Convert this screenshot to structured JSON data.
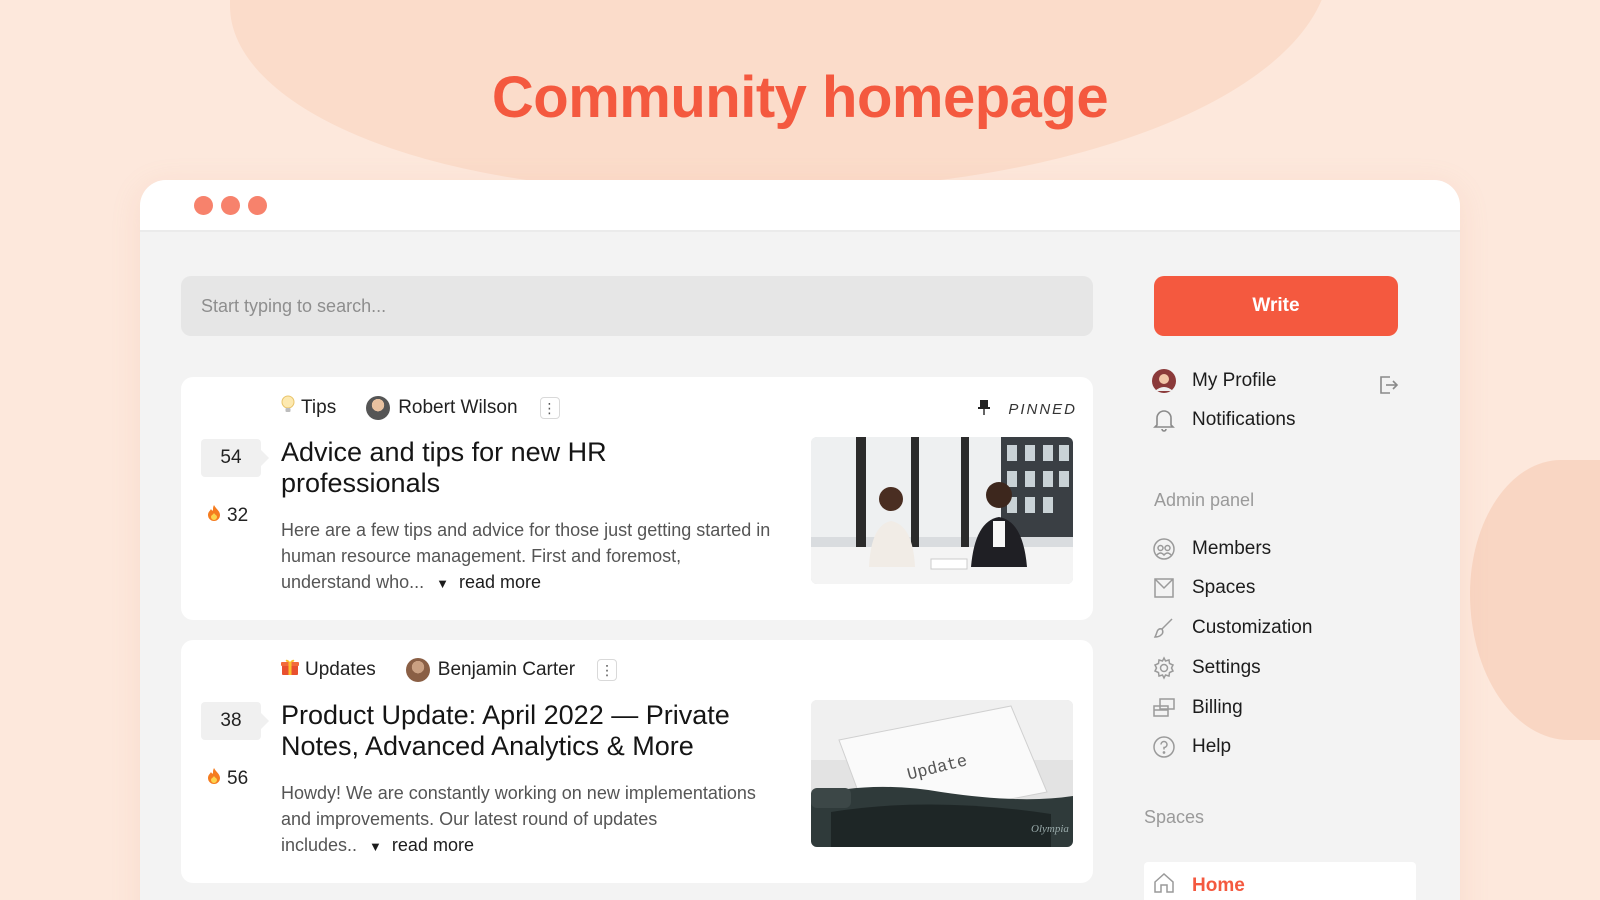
{
  "hero": {
    "title": "Community homepage"
  },
  "search": {
    "placeholder": "Start typing to search..."
  },
  "write_button": "Write",
  "posts": [
    {
      "category": "Tips",
      "category_icon": "lightbulb-icon",
      "author": "Robert Wilson",
      "pinned_label": "PINNED",
      "votes": "54",
      "heat": "32",
      "title": "Advice and tips for new HR professionals",
      "excerpt": "Here are a few tips and advice for those just getting started in human resource management. First and foremost, understand who...",
      "read_more": "read more",
      "image": "two-women-meeting-photo"
    },
    {
      "category": "Updates",
      "category_icon": "gift-icon",
      "author": "Benjamin Carter",
      "votes": "38",
      "heat": "56",
      "title": "Product Update: April 2022 — Private Notes, Advanced Analytics & More",
      "excerpt": "Howdy! We are constantly working on new implementations and improvements. Our latest round of updates includes..",
      "read_more": "read more",
      "image": "typewriter-update-photo",
      "image_text": "Update"
    }
  ],
  "sidebar": {
    "profile": "My Profile",
    "notifications": "Notifications",
    "admin_heading": "Admin panel",
    "admin_items": [
      "Members",
      "Spaces",
      "Customization",
      "Settings",
      "Billing",
      "Help"
    ],
    "spaces_heading": "Spaces",
    "home": "Home"
  },
  "colors": {
    "accent": "#f4593f",
    "background": "#fde8dc",
    "window_dots": "#f7826c"
  }
}
